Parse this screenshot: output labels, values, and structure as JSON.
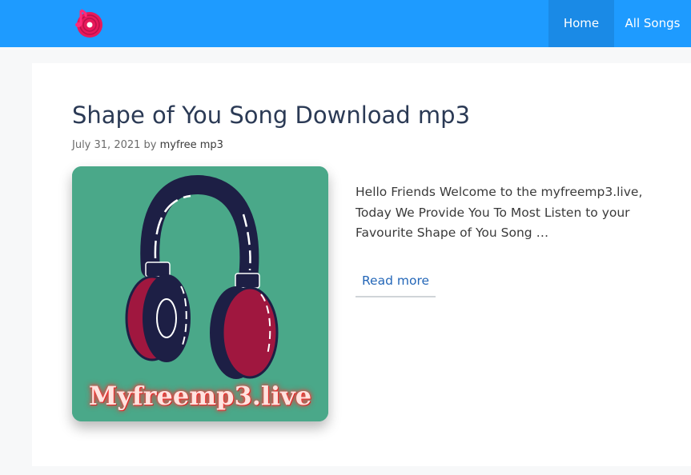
{
  "header": {
    "logo_icon": "music-disc-logo-icon",
    "nav": [
      {
        "label": "Home",
        "active": true
      },
      {
        "label": "All Songs",
        "active": false
      }
    ],
    "colors": {
      "bar": "#1e9bff",
      "active": "#1a8ae6"
    }
  },
  "post": {
    "title": "Shape of You Song Download mp3",
    "date": "July 31, 2021",
    "by": "by",
    "author": "myfree mp3",
    "excerpt": "Hello Friends Welcome to the myfreemp3.live, Today We Provide You To Most Listen to your Favourite Shape of You Song …",
    "read_more": "Read more",
    "thumbnail": {
      "icon": "headphones-icon",
      "caption": "Myfreemp3.live",
      "colors": {
        "background": "#4aa889",
        "band": "#1d1f45",
        "cup": "#a0173f"
      }
    }
  }
}
